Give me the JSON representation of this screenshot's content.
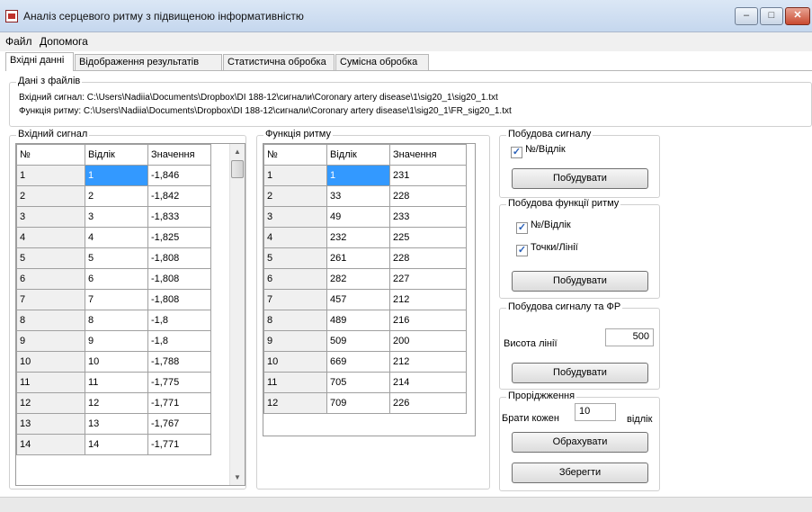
{
  "window": {
    "title": "Аналіз серцевого ритму з підвищеною інформативністю",
    "icon": "app-icon",
    "controls": {
      "minimize": "–",
      "maximize": "□",
      "close": "✕"
    }
  },
  "menu": [
    "Файл",
    "Допомога"
  ],
  "tabs": [
    "Вхідні данні",
    "Відображення результатів",
    "Статистична обробка",
    "Сумісна обробка"
  ],
  "active_tab": "Вхідні данні",
  "files": {
    "title": "Дані з файлів",
    "signal_line": "Вхідний сигнал: C:\\Users\\Nadiia\\Documents\\Dropbox\\DI 188-12\\сигнали\\Coronary artery disease\\1\\sig20_1\\sig20_1.txt",
    "rhythm_line": "Функція ритму: C:\\Users\\Nadiia\\Documents\\Dropbox\\DI 188-12\\сигнали\\Coronary artery disease\\1\\sig20_1\\FR_sig20_1.txt"
  },
  "input_signal": {
    "title": "Вхідний сигнал",
    "columns": [
      "№",
      "Відлік",
      "Значення"
    ],
    "rows": [
      [
        "1",
        "1",
        "-1,846"
      ],
      [
        "2",
        "2",
        "-1,842"
      ],
      [
        "3",
        "3",
        "-1,833"
      ],
      [
        "4",
        "4",
        "-1,825"
      ],
      [
        "5",
        "5",
        "-1,808"
      ],
      [
        "6",
        "6",
        "-1,808"
      ],
      [
        "7",
        "7",
        "-1,808"
      ],
      [
        "8",
        "8",
        "-1,8"
      ],
      [
        "9",
        "9",
        "-1,8"
      ],
      [
        "10",
        "10",
        "-1,788"
      ],
      [
        "11",
        "11",
        "-1,775"
      ],
      [
        "12",
        "12",
        "-1,771"
      ],
      [
        "13",
        "13",
        "-1,767"
      ],
      [
        "14",
        "14",
        "-1,771"
      ]
    ],
    "scroll": {
      "up": "▲",
      "down": "▼"
    }
  },
  "rhythm_function": {
    "title": "Функція ритму",
    "columns": [
      "№",
      "Відлік",
      "Значення"
    ],
    "rows": [
      [
        "1",
        "1",
        "231"
      ],
      [
        "2",
        "33",
        "228"
      ],
      [
        "3",
        "49",
        "233"
      ],
      [
        "4",
        "232",
        "225"
      ],
      [
        "5",
        "261",
        "228"
      ],
      [
        "6",
        "282",
        "227"
      ],
      [
        "7",
        "457",
        "212"
      ],
      [
        "8",
        "489",
        "216"
      ],
      [
        "9",
        "509",
        "200"
      ],
      [
        "10",
        "669",
        "212"
      ],
      [
        "11",
        "705",
        "214"
      ],
      [
        "12",
        "709",
        "226"
      ]
    ]
  },
  "build_signal": {
    "title": "Побудова сигналу",
    "checkbox": {
      "label": "№/Відлік",
      "checked": true
    },
    "button": "Побудувати"
  },
  "build_rhythm": {
    "title": "Побудова функції ритму",
    "checkbox1": {
      "label": "№/Відлік",
      "checked": true
    },
    "checkbox2": {
      "label": "Точки/Лінії",
      "checked": true
    },
    "button": "Побудувати"
  },
  "build_signal_fr": {
    "title": "Побудова сигналу та ФР",
    "line_height_label": "Висота лінії",
    "line_height_value": "500",
    "button": "Побудувати"
  },
  "thinning": {
    "title": "Проріджження",
    "take_every_label": "Брати кожен",
    "take_every_value": "10",
    "unit_label": "відлік",
    "calc_button": "Обрахувати",
    "save_button": "Зберегти"
  },
  "check_mark": "✓",
  "colors": {
    "selection": "#3399ff",
    "titlebar": "#c5d7ee",
    "close_button": "#c94a30"
  }
}
